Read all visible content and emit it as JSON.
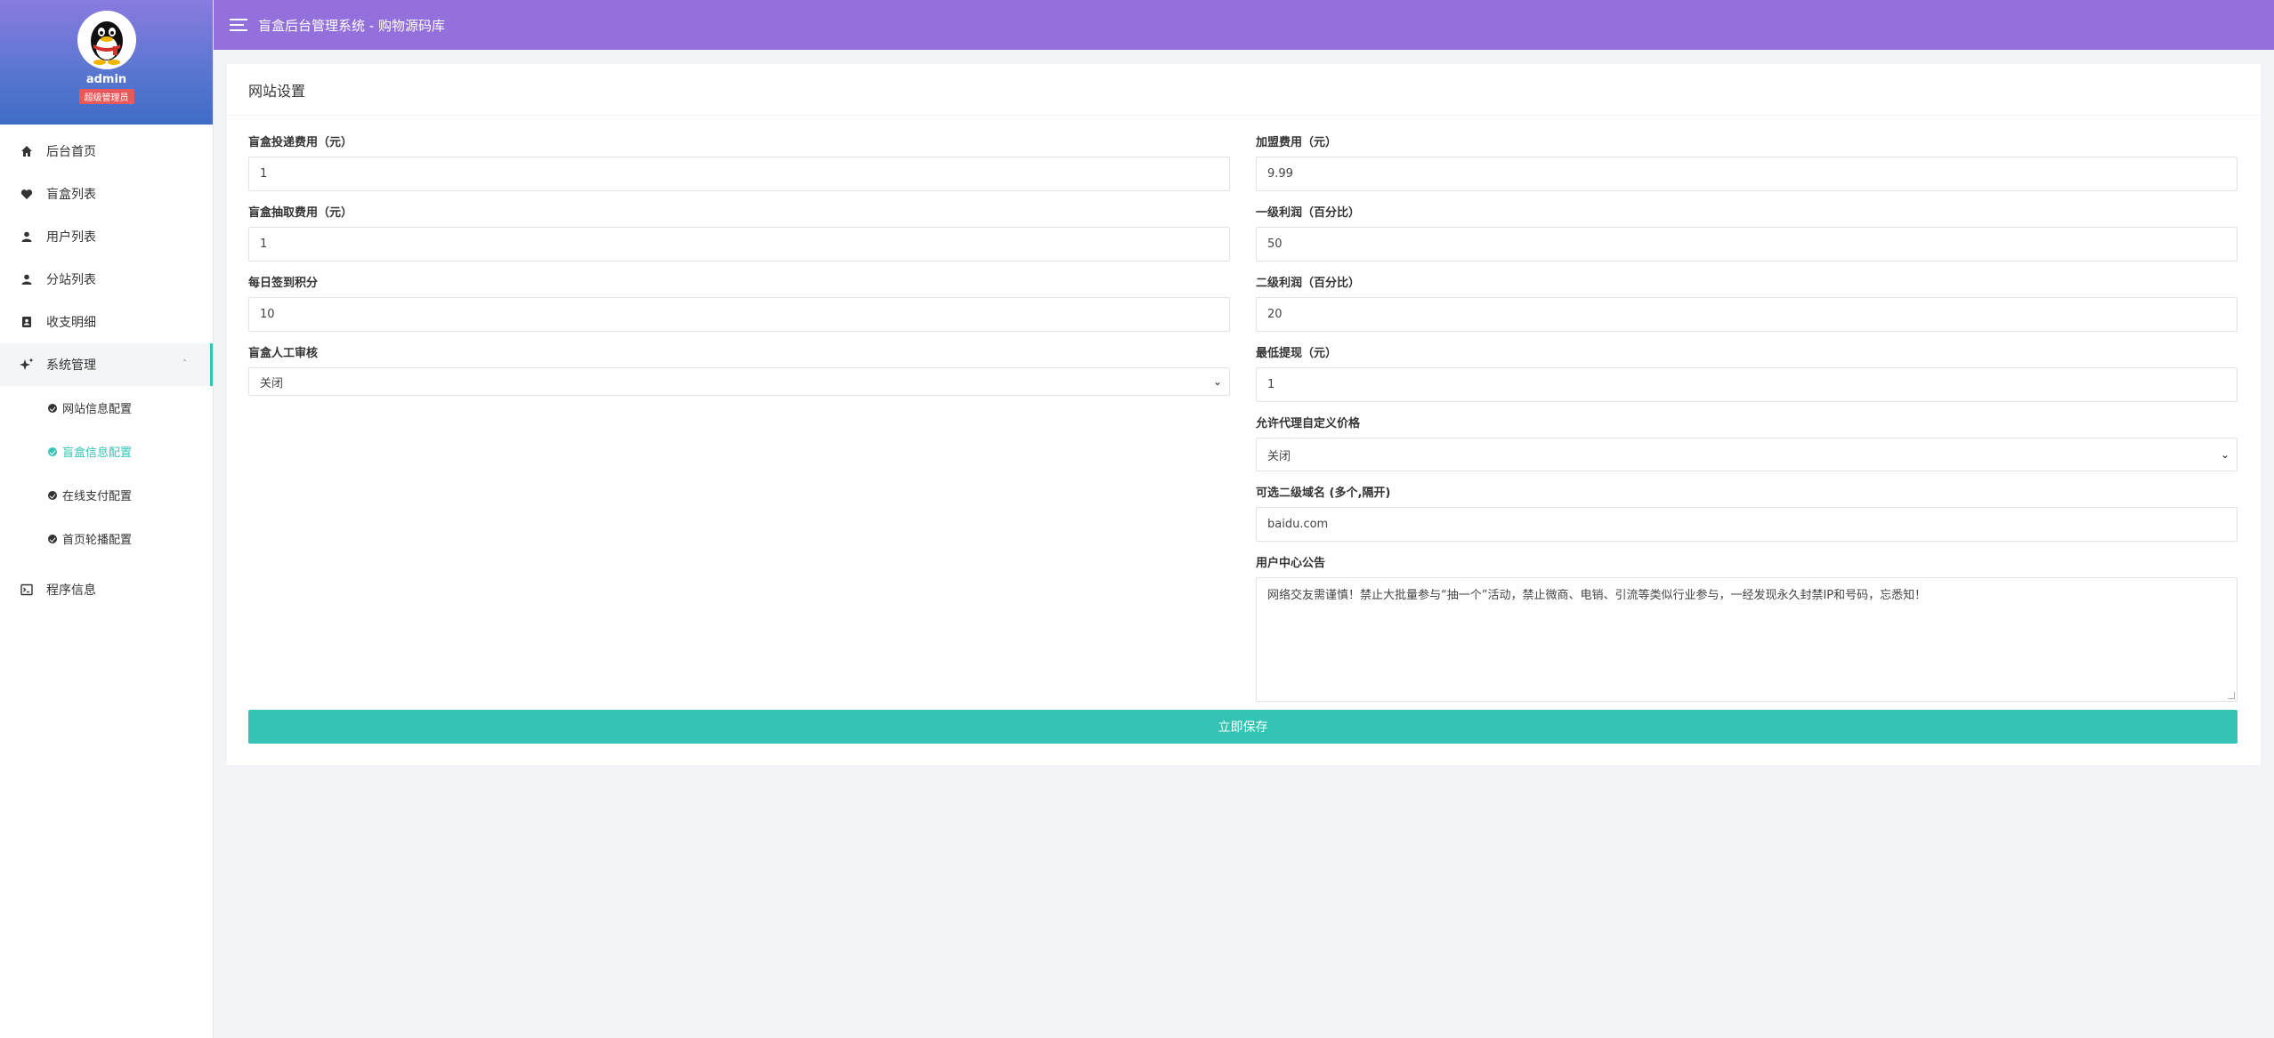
{
  "sidebar": {
    "user": {
      "name": "admin",
      "role": "超级管理员"
    },
    "nav": [
      {
        "label": "后台首页",
        "icon": "home-icon"
      },
      {
        "label": "盲盒列表",
        "icon": "heart-icon"
      },
      {
        "label": "用户列表",
        "icon": "user-icon"
      },
      {
        "label": "分站列表",
        "icon": "user-icon"
      },
      {
        "label": "收支明细",
        "icon": "contacts-icon"
      },
      {
        "label": "系统管理",
        "icon": "sparkle-icon"
      }
    ],
    "subnav": [
      {
        "label": "网站信息配置"
      },
      {
        "label": "盲盒信息配置"
      },
      {
        "label": "在线支付配置"
      },
      {
        "label": "首页轮播配置"
      }
    ],
    "program_info": {
      "label": "程序信息",
      "icon": "terminal-icon"
    }
  },
  "header": {
    "title": "盲盒后台管理系统 - 购物源码库"
  },
  "card": {
    "title": "网站设置",
    "left": {
      "deliver_fee": {
        "label": "盲盒投递费用（元）",
        "value": "1"
      },
      "draw_fee": {
        "label": "盲盒抽取费用（元）",
        "value": "1"
      },
      "checkin_points": {
        "label": "每日签到积分",
        "value": "10"
      },
      "manual_review": {
        "label": "盲盒人工审核",
        "value": "关闭"
      }
    },
    "right": {
      "join_fee": {
        "label": "加盟费用（元）",
        "value": "9.99"
      },
      "level1_profit": {
        "label": "一级利润（百分比）",
        "value": "50"
      },
      "level2_profit": {
        "label": "二级利润（百分比）",
        "value": "20"
      },
      "min_withdraw": {
        "label": "最低提现（元）",
        "value": "1"
      },
      "agent_custom_price": {
        "label": "允许代理自定义价格",
        "value": "关闭"
      },
      "subdomains": {
        "label": "可选二级域名 (多个,隔开)",
        "value": "baidu.com"
      },
      "notice": {
        "label": "用户中心公告",
        "value": "网络交友需谨慎！禁止大批量参与“抽一个”活动，禁止微商、电销、引流等类似行业参与，一经发现永久封禁IP和号码，忘悉知！"
      }
    },
    "save_label": "立即保存"
  }
}
